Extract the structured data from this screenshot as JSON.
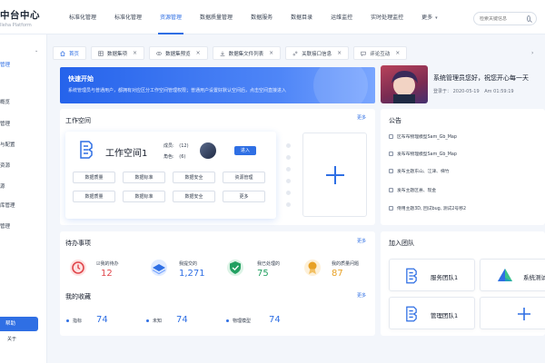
{
  "brand": {
    "title": "中台中心",
    "subtitle": "lleha Platform"
  },
  "nav": [
    {
      "label": "标准化管理"
    },
    {
      "label": "标准化管理"
    },
    {
      "label": "资源管理"
    },
    {
      "label": "数据质量管理"
    },
    {
      "label": "数据服务"
    },
    {
      "label": "数据目录"
    },
    {
      "label": "运维监控"
    },
    {
      "label": "实时处理监控"
    },
    {
      "label": "更多"
    }
  ],
  "search": {
    "placeholder": "检索关键信息"
  },
  "sidebar": {
    "items": [
      {
        "label": "管理"
      },
      {
        "label": "概览"
      },
      {
        "label": "管理"
      },
      {
        "label": "与配置"
      },
      {
        "label": "资源"
      },
      {
        "label": "源"
      },
      {
        "label": "库管理"
      },
      {
        "label": "管理"
      }
    ],
    "help": "帮助",
    "about": "关于"
  },
  "tabs": [
    {
      "label": "首页",
      "icon": "home-icon"
    },
    {
      "label": "数据集项",
      "icon": "dataset-icon"
    },
    {
      "label": "数据集预览",
      "icon": "eye-icon"
    },
    {
      "label": "数据集文件列表",
      "icon": "download-icon"
    },
    {
      "label": "关联接口信息",
      "icon": "link-icon"
    },
    {
      "label": "评论互动",
      "icon": "comment-icon"
    }
  ],
  "banner": {
    "title": "快速开始",
    "desc": "系统管理员与普通用户，都拥有对应区分工作空间管理权限；普通用户设置好默认空间后，点击空间直接进入"
  },
  "profile": {
    "greeting": "系统管理员您好，祝您开心每一天",
    "login_label": "登录于：",
    "login_date": "2020-05-19",
    "login_time": "Am 01:59:19"
  },
  "workspace": {
    "title": "工作空间",
    "more": "更多",
    "name": "工作空间1",
    "members_label": "成员:",
    "members_value": "(12)",
    "roles_label": "角色:",
    "roles_value": "(6)",
    "enter": "进入",
    "buttons": [
      "数据质量",
      "数据标准",
      "数据安全",
      "资源管理",
      "数据质量",
      "数据标准",
      "数据安全",
      "更多"
    ]
  },
  "notices": {
    "title": "公告",
    "items": [
      "区布布物理模型Sam_Gb_Map",
      "发布布物理模型Sam_Gb_Map",
      "发布主题东山、江津、梯竹",
      "发布主题区县、现金",
      "发布主题区县、现金",
      "侍用主题3D, 回试bug, 测试2号移2"
    ]
  },
  "todo": {
    "title": "待办事项",
    "more": "更多",
    "items": [
      {
        "label": "我的待办",
        "value": "12",
        "color": "#e0464b",
        "icon": "alarm-clock-icon"
      },
      {
        "label": "我提交的",
        "value": "1,271",
        "color": "#2f6fe4",
        "icon": "layers-icon"
      },
      {
        "label": "我已处理的",
        "value": "75",
        "color": "#22a061",
        "icon": "shield-check-icon"
      },
      {
        "label": "我的质量问题",
        "value": "87",
        "color": "#e8a125",
        "icon": "ribbon-icon"
      }
    ]
  },
  "favorites": {
    "title": "我的收藏",
    "more": "更多",
    "items": [
      {
        "label": "指标",
        "value": "74"
      },
      {
        "label": "未知",
        "value": "74"
      },
      {
        "label": "物理模型",
        "value": "74"
      }
    ]
  },
  "teams": {
    "title": "加入团队",
    "items": [
      {
        "name": "服务团队1",
        "icon": "service-team-icon"
      },
      {
        "name": "系统测试团队",
        "icon": "system-test-icon"
      },
      {
        "name": "管理团队1",
        "icon": "management-team-icon"
      }
    ]
  }
}
